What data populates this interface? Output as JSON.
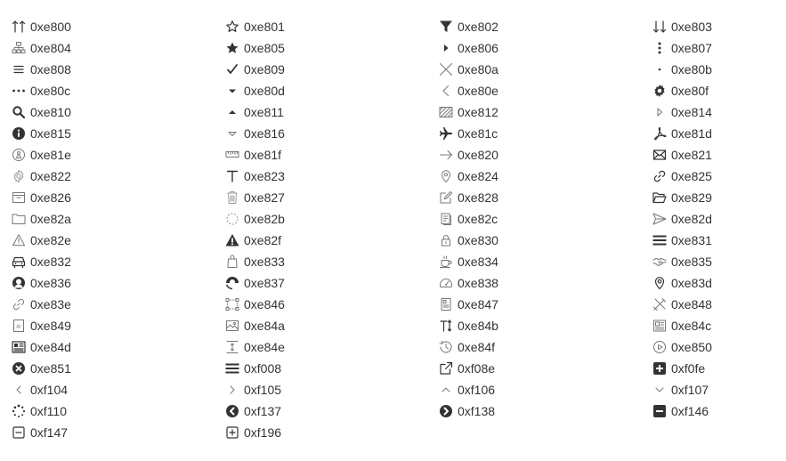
{
  "icons": [
    {
      "code": "0xe800",
      "icon": "sort-up-arrows-icon"
    },
    {
      "code": "0xe801",
      "icon": "star-outline-icon"
    },
    {
      "code": "0xe802",
      "icon": "filter-funnel-icon"
    },
    {
      "code": "0xe803",
      "icon": "sort-down-arrows-icon"
    },
    {
      "code": "0xe804",
      "icon": "sitemap-icon"
    },
    {
      "code": "0xe805",
      "icon": "star-filled-icon"
    },
    {
      "code": "0xe806",
      "icon": "caret-right-icon"
    },
    {
      "code": "0xe807",
      "icon": "ellipsis-vertical-icon"
    },
    {
      "code": "0xe808",
      "icon": "menu-lines-icon"
    },
    {
      "code": "0xe809",
      "icon": "checkmark-icon"
    },
    {
      "code": "0xe80a",
      "icon": "close-x-icon"
    },
    {
      "code": "0xe80b",
      "icon": "dot-icon"
    },
    {
      "code": "0xe80c",
      "icon": "ellipsis-horizontal-icon"
    },
    {
      "code": "0xe80d",
      "icon": "caret-down-icon"
    },
    {
      "code": "0xe80e",
      "icon": "chevron-left-thin-icon"
    },
    {
      "code": "0xe80f",
      "icon": "gear-filled-icon"
    },
    {
      "code": "0xe810",
      "icon": "search-icon"
    },
    {
      "code": "0xe811",
      "icon": "caret-up-icon"
    },
    {
      "code": "0xe812",
      "icon": "hatched-box-icon"
    },
    {
      "code": "0xe814",
      "icon": "caret-right-outline-icon"
    },
    {
      "code": "0xe815",
      "icon": "info-circle-icon"
    },
    {
      "code": "0xe816",
      "icon": "caret-down-outline-icon"
    },
    {
      "code": "0xe81c",
      "icon": "airplane-icon"
    },
    {
      "code": "0xe81d",
      "icon": "pdf-logo-icon"
    },
    {
      "code": "0xe81e",
      "icon": "person-circle-icon"
    },
    {
      "code": "0xe81f",
      "icon": "ruler-icon"
    },
    {
      "code": "0xe820",
      "icon": "arrow-right-icon"
    },
    {
      "code": "0xe821",
      "icon": "envelope-icon"
    },
    {
      "code": "0xe822",
      "icon": "gear-outline-icon"
    },
    {
      "code": "0xe823",
      "icon": "text-t-icon"
    },
    {
      "code": "0xe824",
      "icon": "map-pin-icon"
    },
    {
      "code": "0xe825",
      "icon": "link-icon"
    },
    {
      "code": "0xe826",
      "icon": "archive-box-icon"
    },
    {
      "code": "0xe827",
      "icon": "trash-icon"
    },
    {
      "code": "0xe828",
      "icon": "edit-square-icon"
    },
    {
      "code": "0xe829",
      "icon": "folder-open-icon"
    },
    {
      "code": "0xe82a",
      "icon": "folder-icon"
    },
    {
      "code": "0xe82b",
      "icon": "dashed-circle-icon"
    },
    {
      "code": "0xe82c",
      "icon": "copy-document-icon"
    },
    {
      "code": "0xe82d",
      "icon": "send-icon"
    },
    {
      "code": "0xe82e",
      "icon": "warning-outline-icon"
    },
    {
      "code": "0xe82f",
      "icon": "warning-filled-icon"
    },
    {
      "code": "0xe830",
      "icon": "lock-icon"
    },
    {
      "code": "0xe831",
      "icon": "menu-bold-icon"
    },
    {
      "code": "0xe832",
      "icon": "car-icon"
    },
    {
      "code": "0xe833",
      "icon": "shopping-bag-icon"
    },
    {
      "code": "0xe834",
      "icon": "coffee-cup-icon"
    },
    {
      "code": "0xe835",
      "icon": "handshake-icon"
    },
    {
      "code": "0xe836",
      "icon": "user-avatar-icon"
    },
    {
      "code": "0xe837",
      "icon": "user-partial-icon"
    },
    {
      "code": "0xe838",
      "icon": "dashboard-gauge-icon"
    },
    {
      "code": "0xe83d",
      "icon": "map-pin-outline-icon"
    },
    {
      "code": "0xe83e",
      "icon": "link-outline-icon"
    },
    {
      "code": "0xe846",
      "icon": "selection-box-icon"
    },
    {
      "code": "0xe847",
      "icon": "document-page-icon"
    },
    {
      "code": "0xe848",
      "icon": "tools-cross-icon"
    },
    {
      "code": "0xe849",
      "icon": "ai-document-icon"
    },
    {
      "code": "0xe84a",
      "icon": "image-icon"
    },
    {
      "code": "0xe84b",
      "icon": "text-height-icon"
    },
    {
      "code": "0xe84c",
      "icon": "newspaper-icon"
    },
    {
      "code": "0xe84d",
      "icon": "newspaper-alt-icon"
    },
    {
      "code": "0xe84e",
      "icon": "vertical-align-icon"
    },
    {
      "code": "0xe84f",
      "icon": "history-clock-icon"
    },
    {
      "code": "0xe850",
      "icon": "play-circle-icon"
    },
    {
      "code": "0xe851",
      "icon": "close-circle-filled-icon"
    },
    {
      "code": "0xf008",
      "icon": "list-bars-icon"
    },
    {
      "code": "0xf08e",
      "icon": "external-link-icon"
    },
    {
      "code": "0xf0fe",
      "icon": "plus-square-icon"
    },
    {
      "code": "0xf104",
      "icon": "angle-left-icon"
    },
    {
      "code": "0xf105",
      "icon": "angle-right-icon"
    },
    {
      "code": "0xf106",
      "icon": "angle-up-icon"
    },
    {
      "code": "0xf107",
      "icon": "angle-down-icon"
    },
    {
      "code": "0xf110",
      "icon": "spinner-icon"
    },
    {
      "code": "0xf137",
      "icon": "chevron-circle-left-icon"
    },
    {
      "code": "0xf138",
      "icon": "chevron-circle-right-icon"
    },
    {
      "code": "0xf146",
      "icon": "minus-square-icon"
    },
    {
      "code": "0xf147",
      "icon": "minus-square-outline-icon"
    },
    {
      "code": "0xf196",
      "icon": "plus-square-outline-icon"
    }
  ]
}
